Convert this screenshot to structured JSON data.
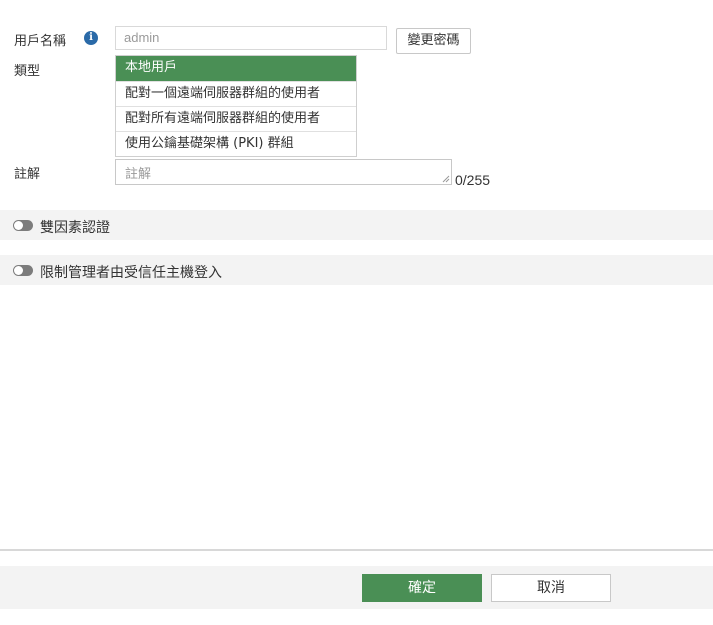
{
  "form": {
    "username_label": "用戶名稱",
    "info_icon": "info-icon",
    "username_value": "admin",
    "change_password_label": "變更密碼",
    "type_label": "類型",
    "type_options": [
      "本地用戶",
      "配對一個遠端伺服器群組的使用者",
      "配對所有遠端伺服器群組的使用者",
      "使用公鑰基礎架構 (PKI) 群組"
    ],
    "type_selected_index": 0,
    "comment_label": "註解",
    "comment_placeholder": "註解",
    "comment_counter": "0/255"
  },
  "sections": {
    "two_factor_label": "雙因素認證",
    "two_factor_enabled": false,
    "trusted_hosts_label": "限制管理者由受信任主機登入",
    "trusted_hosts_enabled": false
  },
  "footer": {
    "ok_label": "確定",
    "cancel_label": "取消"
  },
  "colors": {
    "accent": "#4a8f55",
    "info": "#2a6aa8",
    "toggle_off": "#7c7c7c"
  }
}
